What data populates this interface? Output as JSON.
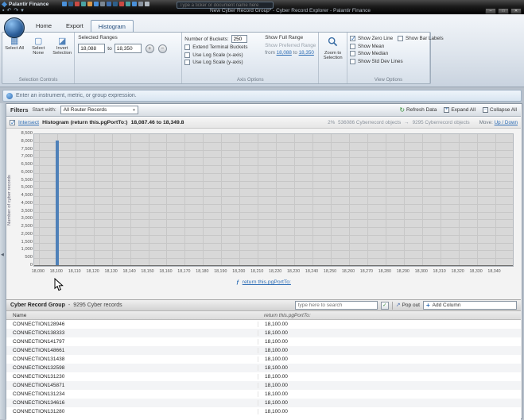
{
  "colors": {
    "accent": "#2d6db5",
    "bar": "#4f81b9"
  },
  "glyphs": {
    "check": "✓",
    "caret": "▾",
    "collapse_left": "◀",
    "plus": "+",
    "minus": "−",
    "popout": "↗",
    "fx": "ƒ",
    "refresh": "↻",
    "expand": "+",
    "collapse": "−"
  },
  "titlebar": {
    "app": "Palantir Finance",
    "search_placeholder": "Type a ticker or document name here",
    "title": "New Cyber Record Group* - Cyber Record Explorer - Palantir Finance",
    "quick_icons": [
      {
        "name": "save-icon",
        "glyph": "▪"
      },
      {
        "name": "undo-icon",
        "glyph": "↶"
      },
      {
        "name": "redo-icon",
        "glyph": "↷"
      },
      {
        "name": "dropdown-icon",
        "glyph": "▾"
      }
    ],
    "app_icon_colors": [
      "#4a90d9",
      "#2e5f8a",
      "#c94a43",
      "#4aa3a3",
      "#d9984a",
      "#4a90d9",
      "#7b8794",
      "#3f6fae",
      "#2e5f8a",
      "#c94a43",
      "#4aa3a3",
      "#4a90d9",
      "#8a94a0",
      "#b0b8c0"
    ],
    "window_controls": [
      {
        "name": "minimize-button",
        "glyph": "–"
      },
      {
        "name": "maximize-button",
        "glyph": "□"
      },
      {
        "name": "close-button",
        "glyph": "✕"
      }
    ]
  },
  "ribbon": {
    "tabs": [
      {
        "label": "Home",
        "active": false
      },
      {
        "label": "Export",
        "active": false
      },
      {
        "label": "Histogram",
        "active": true
      }
    ],
    "selection_controls": {
      "group_label": "Selection Controls",
      "buttons": [
        {
          "label": "Select All",
          "icon": "select-all-icon",
          "glyph": "▦"
        },
        {
          "label": "Select None",
          "icon": "select-none-icon",
          "glyph": "▢"
        },
        {
          "label": "Invert Selection",
          "icon": "invert-selection-icon",
          "glyph": "◪"
        }
      ]
    },
    "selected_ranges": {
      "group_label": "Selected Ranges",
      "from_value": "18,088",
      "to_word": "to",
      "to_value": "18,350"
    },
    "axis_options": {
      "group_label": "Axis Options",
      "buckets_label": "Number of Buckets:",
      "buckets_value": "250",
      "checkboxes": [
        {
          "label": "Extend Terminal Buckets",
          "checked": false
        },
        {
          "label": "Use Log Scale (x-axis)",
          "checked": false
        },
        {
          "label": "Use Log Scale (y-axis)",
          "checked": false
        }
      ],
      "show_full_range": "Show Full Range",
      "show_preferred_range": "Show Preferred Range",
      "from_word": "from",
      "from_link": "18,088",
      "to_word": "to",
      "to_link": "18,350"
    },
    "zoom_button": {
      "label_line1": "Zoom to",
      "label_line2": "Selection"
    },
    "view_options": {
      "group_label": "View Options",
      "items": [
        {
          "label": "Show Zero Line",
          "checked": true,
          "col": 1
        },
        {
          "label": "Show Mean",
          "checked": false,
          "col": 1
        },
        {
          "label": "Show Median",
          "checked": false,
          "col": 1
        },
        {
          "label": "Show Std Dev Lines",
          "checked": false,
          "col": 1
        },
        {
          "label": "Show Bar Labels",
          "checked": false,
          "col": 2
        }
      ]
    }
  },
  "expression_bar": {
    "prompt": "Enter an instrument, metric, or group expression."
  },
  "filters": {
    "title": "Filters",
    "start_with_label": "Start with:",
    "dropdown_value": "All Router Records",
    "refresh_label": "Refresh Data",
    "expand_label": "Expand All",
    "collapse_label": "Collapse All"
  },
  "histogram_panel": {
    "intersect_label": "Intersect",
    "title": "Histogram (return this.pgPortTo:)",
    "range": "18,087.46 to 18,349.8",
    "percent": "2%",
    "source_count": "536086 Cyberrecord objects",
    "arrow_glyph": "→",
    "result_count": "9295 Cyberrecord objects",
    "move_label": "Move:",
    "move_links": "Up / Down",
    "link": "return this.pgPortTo:"
  },
  "chart_data": {
    "type": "bar",
    "title": "Histogram (return this.pgPortTo:)",
    "ylabel": "Number of cyber records",
    "xlabel": "",
    "xlim": [
      18087.46,
      18349.8
    ],
    "ylim": [
      0,
      8500
    ],
    "y_tick_step": 500,
    "x_ticks": [
      18090,
      18100,
      18110,
      18120,
      18130,
      18140,
      18150,
      18160,
      18170,
      18180,
      18190,
      18200,
      18210,
      18220,
      18230,
      18240,
      18250,
      18260,
      18270,
      18280,
      18290,
      18300,
      18310,
      18320,
      18330,
      18340
    ],
    "bars": [
      {
        "x": 18100,
        "count": 8100
      }
    ],
    "grid": true,
    "bar_color": "#4f81b9",
    "legend": "none"
  },
  "table": {
    "title": "Cyber Record Group",
    "dash": "-",
    "count": "9295 Cyber records",
    "search_placeholder": "type here to search",
    "popout_label": "Pop out",
    "add_column_label": "Add Column",
    "columns": [
      "Name",
      "return this.pgPortTo:"
    ],
    "rows": [
      {
        "name": "CONNECTION128946",
        "value": "18,100.00"
      },
      {
        "name": "CONNECTION138333",
        "value": "18,100.00"
      },
      {
        "name": "CONNECTION141797",
        "value": "18,100.00"
      },
      {
        "name": "CONNECTION148661",
        "value": "18,100.00"
      },
      {
        "name": "CONNECTION131438",
        "value": "18,100.00"
      },
      {
        "name": "CONNECTION132598",
        "value": "18,100.00"
      },
      {
        "name": "CONNECTION131230",
        "value": "18,100.00"
      },
      {
        "name": "CONNECTION145871",
        "value": "18,100.00"
      },
      {
        "name": "CONNECTION131234",
        "value": "18,100.00"
      },
      {
        "name": "CONNECTION134616",
        "value": "18,100.00"
      },
      {
        "name": "CONNECTION131280",
        "value": "18,100.00"
      }
    ]
  }
}
